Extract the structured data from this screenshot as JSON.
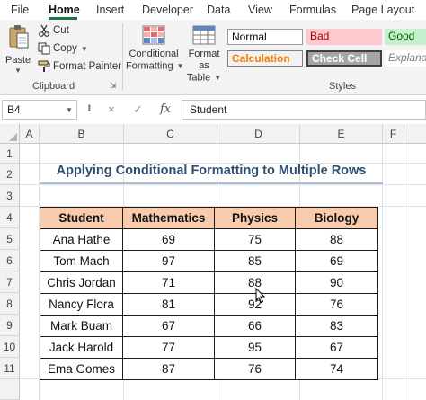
{
  "menu": {
    "tabs": [
      "File",
      "Home",
      "Insert",
      "Developer",
      "Data",
      "View",
      "Formulas",
      "Page Layout"
    ],
    "active": "Home"
  },
  "ribbon": {
    "clipboard": {
      "paste": "Paste",
      "cut": "Cut",
      "copy": "Copy",
      "format_painter": "Format Painter",
      "group_label": "Clipboard"
    },
    "styles": {
      "conditional_formatting": [
        "Conditional",
        "Formatting"
      ],
      "format_as_table": [
        "Format as",
        "Table"
      ],
      "cells": [
        {
          "label": "Normal",
          "bg": "#ffffff",
          "fg": "#000000",
          "border": "#9a9a9a"
        },
        {
          "label": "Bad",
          "bg": "#ffc7ce",
          "fg": "#9c0006",
          "border": "#ffc7ce"
        },
        {
          "label": "Good",
          "bg": "#c6efce",
          "fg": "#006100",
          "border": "#c6efce"
        },
        {
          "label": "Calculation",
          "bg": "#f2f2f2",
          "fg": "#fa7d00",
          "border": "#7f7f7f"
        },
        {
          "label": "Check Cell",
          "bg": "#a5a5a5",
          "fg": "#ffffff",
          "border": "#3f3f3f"
        },
        {
          "label": "Explanatory ...",
          "bg": "#ffffff",
          "fg": "#7f7f7f",
          "border": "#ffffff"
        }
      ],
      "group_label": "Styles"
    }
  },
  "formula_bar": {
    "name_box": "B4",
    "cancel_icon": "×",
    "enter_icon": "✓",
    "fx": "fx",
    "content": "Student"
  },
  "sheet": {
    "columns": [
      "A",
      "B",
      "C",
      "D",
      "E",
      "F"
    ],
    "rows": [
      "1",
      "2",
      "3",
      "4",
      "5",
      "6",
      "7",
      "8",
      "9",
      "10",
      "11"
    ],
    "title": "Applying Conditional Formatting to Multiple Rows",
    "header_fill": "#f8cbad",
    "table": {
      "headers": [
        "Student",
        "Mathematics",
        "Physics",
        "Biology"
      ],
      "rows": [
        [
          "Ana Hathe",
          "69",
          "75",
          "88"
        ],
        [
          "Tom Mach",
          "97",
          "85",
          "69"
        ],
        [
          "Chris Jordan",
          "71",
          "88",
          "90"
        ],
        [
          "Nancy Flora",
          "81",
          "92",
          "76"
        ],
        [
          "Mark Buam",
          "67",
          "66",
          "83"
        ],
        [
          "Jack Harold",
          "77",
          "95",
          "67"
        ],
        [
          "Ema Gomes",
          "87",
          "76",
          "74"
        ]
      ]
    }
  },
  "colors": {
    "accent": "#217346",
    "title": "#2f4f6f"
  }
}
